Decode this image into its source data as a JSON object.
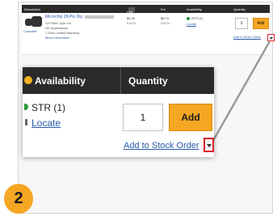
{
  "table_header": {
    "description": "Description",
    "unit": "Unit",
    "ext": "Ext",
    "availability": "Availability",
    "quantity": "Quantity"
  },
  "product": {
    "title": "Microchip 28-Pin Dip",
    "compare": "Compare",
    "line1": "CH Filter, Spin On",
    "line2": "OK Applications",
    "line3": "1 Year Limited Warranty",
    "line4": "More Information",
    "unit_price": "$4.45",
    "unit_label": "EACH",
    "ext_price": "$8.75",
    "ext_label": "EACH",
    "mini_stock": "STR (1)",
    "mini_locate": "Locate",
    "mini_qty": "1",
    "mini_add": "Add",
    "mini_aso": "Add to Stock Order"
  },
  "zoom": {
    "availability_header": "Availability",
    "quantity_header": "Quantity",
    "stock_status": "STR (1)",
    "locate_link": "Locate",
    "quantity_value": "1",
    "add_button": "Add",
    "add_to_stock_order": "Add to Stock Order"
  },
  "step_number": "2",
  "colors": {
    "accent": "#f5a623",
    "highlight": "#d9252a",
    "header_bg": "#2a2a2a",
    "link": "#2a5aa8"
  }
}
